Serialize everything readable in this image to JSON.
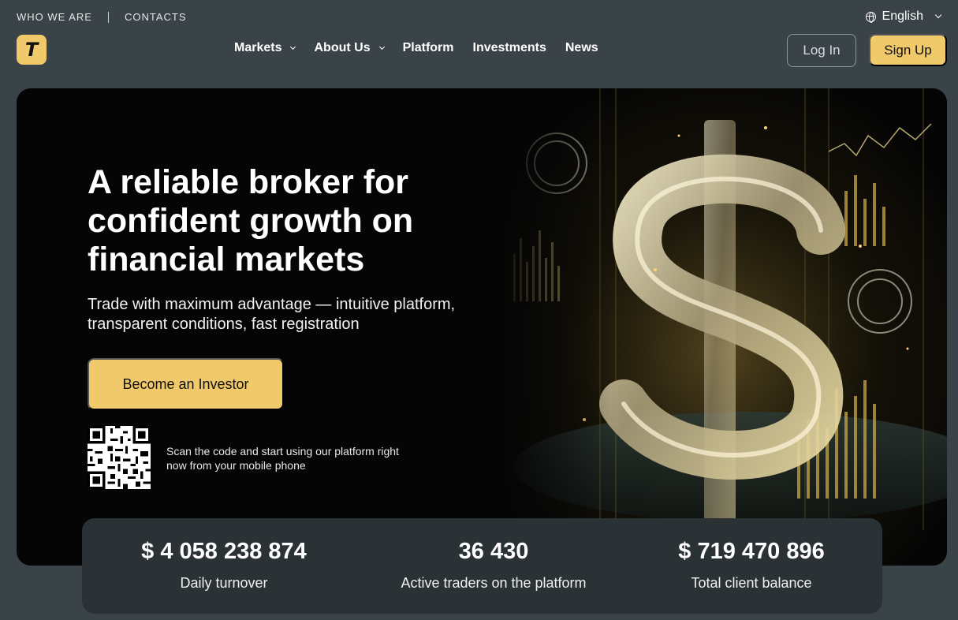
{
  "topbar": {
    "who_we_are": "WHO WE ARE",
    "contacts": "CONTACTS",
    "language": "English"
  },
  "logo": {
    "letter": "T"
  },
  "nav": {
    "items": [
      {
        "label": "Markets",
        "dropdown": true
      },
      {
        "label": "About Us",
        "dropdown": true
      },
      {
        "label": "Platform",
        "dropdown": false
      },
      {
        "label": "Investments",
        "dropdown": false
      },
      {
        "label": "News",
        "dropdown": false
      }
    ]
  },
  "auth": {
    "login": "Log In",
    "signup": "Sign Up"
  },
  "hero": {
    "title": "A reliable broker for confident growth on financial markets",
    "subtitle": "Trade with maximum advantage — intuitive platform, transparent conditions, fast registration",
    "cta": "Become an Investor",
    "qr_text": "Scan the code and start using our platform right now from your mobile phone"
  },
  "stats": [
    {
      "value": "$ 4 058 238 874",
      "label": "Daily turnover"
    },
    {
      "value": "36 430",
      "label": "Active traders on the platform"
    },
    {
      "value": "$ 719 470 896",
      "label": "Total client balance"
    }
  ],
  "colors": {
    "accent": "#f0c96b",
    "page_bg": "#3a4448",
    "hero_bg": "#050505",
    "stats_bg": "#2b3236"
  }
}
